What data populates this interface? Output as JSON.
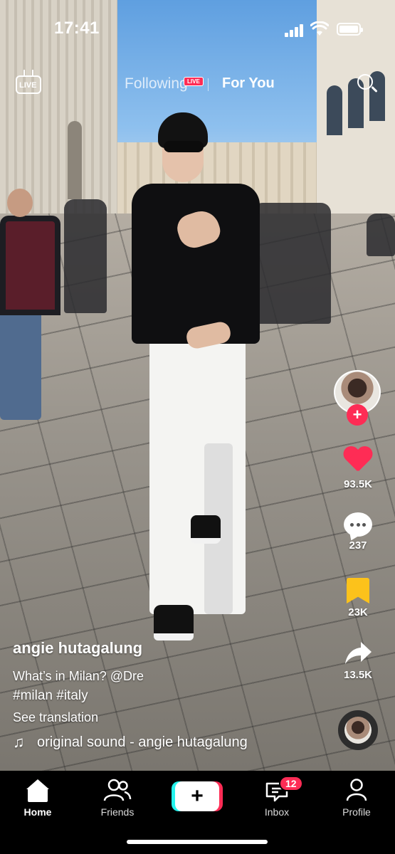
{
  "status_bar": {
    "time": "17:41"
  },
  "top_nav": {
    "live_label": "LIVE",
    "following_label": "Following",
    "live_badge": "LIVE",
    "for_you_label": "For You"
  },
  "actions": {
    "likes": "93.5K",
    "comments": "237",
    "saves": "23K",
    "shares": "13.5K",
    "accent_color": "#fe2c55",
    "bookmark_color": "#fcc21b"
  },
  "caption": {
    "username": "angie hutagalung",
    "description": "What’s in Milan? @Dre",
    "hashtags": "#milan #italy",
    "see_translation": "See translation",
    "sound": "original sound - angie hutagalung"
  },
  "tab_bar": {
    "home": "Home",
    "friends": "Friends",
    "create": "+",
    "inbox": "Inbox",
    "inbox_badge": "12",
    "profile": "Profile"
  }
}
